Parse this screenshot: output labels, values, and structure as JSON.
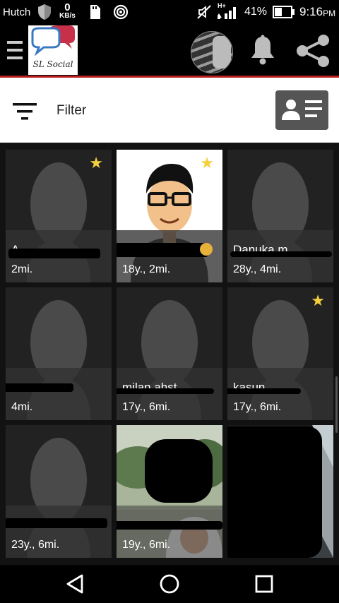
{
  "status": {
    "carrier": "Hutch",
    "speed_value": "0",
    "speed_unit": "KB/s",
    "network_type": "H+",
    "battery": "41%",
    "time": "9:16",
    "time_suffix": "PM"
  },
  "app": {
    "logo_text": "SL Social"
  },
  "filter": {
    "label": "Filter"
  },
  "profiles": [
    {
      "name": "A",
      "meta": "2mi.",
      "starred": true,
      "photo": "placeholder"
    },
    {
      "name": "",
      "meta": "18y., 2mi.",
      "starred": true,
      "photo": "avatar"
    },
    {
      "name": "Danuka m",
      "meta": "28y., 4mi.",
      "starred": false,
      "photo": "placeholder"
    },
    {
      "name": "",
      "meta": "4mi.",
      "starred": false,
      "photo": "placeholder"
    },
    {
      "name": "milan ahst",
      "meta": "17y., 6mi.",
      "starred": false,
      "photo": "placeholder"
    },
    {
      "name": "kasun",
      "meta": "17y., 6mi.",
      "starred": true,
      "photo": "placeholder"
    },
    {
      "name": "",
      "meta": "23y., 6mi.",
      "starred": false,
      "photo": "placeholder"
    },
    {
      "name": "",
      "meta": "19y., 6mi.",
      "starred": false,
      "photo": "outdoor"
    },
    {
      "name": "",
      "meta": "",
      "starred": false,
      "photo": "dark"
    }
  ],
  "colors": {
    "accent": "#b3201d",
    "star": "#f4d03f",
    "logo_bubble_red": "#c8304a",
    "logo_bubble_blue": "#3a78c2"
  }
}
